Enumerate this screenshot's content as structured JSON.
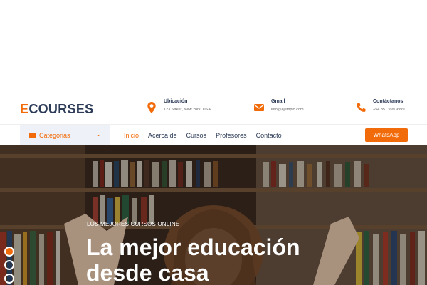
{
  "brand": {
    "first": "E",
    "rest": "COURSES",
    "accent": "#f26b0a",
    "dark": "#2b3a57"
  },
  "contacts": [
    {
      "icon": "location-pin-icon",
      "title": "Ubicación",
      "text": "123 Street, New York, USA"
    },
    {
      "icon": "envelope-icon",
      "title": "Gmail",
      "text": "info@ejemplo.com"
    },
    {
      "icon": "phone-icon",
      "title": "Contáctanos",
      "text": "+54 351 999 9999"
    }
  ],
  "categories": {
    "label": "Categorias",
    "icon": "book-icon"
  },
  "nav": [
    "Inicio",
    "Acerca de",
    "Cursos",
    "Profesores",
    "Contacto"
  ],
  "cta": "WhatsApp",
  "hero": {
    "subtitle": "LOS MEJORES CURSOS ONLINE",
    "title": "La mejor educación desde casa"
  },
  "carousel": {
    "slides": 3,
    "active": 1
  }
}
